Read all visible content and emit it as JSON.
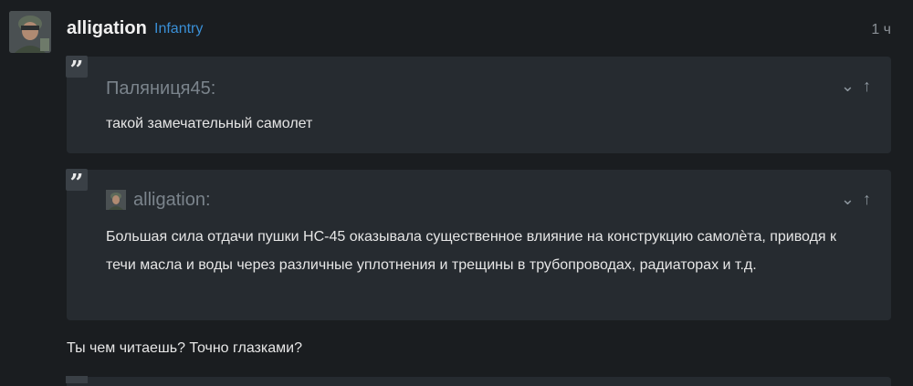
{
  "post": {
    "author": "alligation",
    "rank": "Infantry",
    "time": "1 ч"
  },
  "quotes": [
    {
      "author": "Паляниця45:",
      "text": "такой замечательный самолет",
      "controls": {
        "expand": "⌄",
        "up": "↑"
      }
    },
    {
      "author": "alligation:",
      "text": "Большая сила отдачи пушки НС-45 оказывала существенное влияние на конструкцию самолѐта, приводя к течи масла и воды через различные уплотнения и трещины в трубопроводах, радиаторах и т.д.",
      "controls": {
        "expand": "⌄",
        "up": "↑"
      }
    }
  ],
  "reply_text": "Ты чем читаешь? Точно глазками?",
  "icons": {
    "quote": "”"
  }
}
